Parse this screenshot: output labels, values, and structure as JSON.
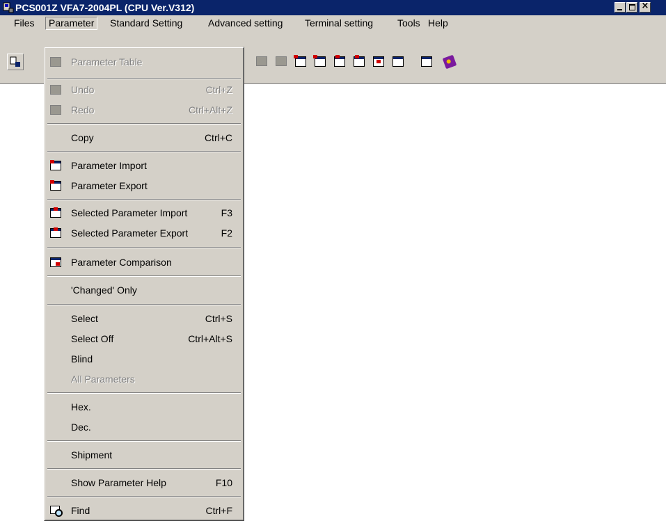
{
  "window": {
    "title": "PCS001Z VFA7-2004PL (CPU Ver.V312)",
    "close_glyph": "×"
  },
  "menubar": [
    "Files",
    "Parameter",
    "Standard Setting",
    "Advanced setting",
    "Terminal setting",
    "Tools",
    "Help"
  ],
  "open_menu": "Parameter",
  "dropdown": [
    {
      "label": "Parameter Table",
      "shortcut": "",
      "icon": "parameter-table-icon",
      "disabled": true
    },
    {
      "label": "Undo",
      "shortcut": "Ctrl+Z",
      "icon": "undo-icon",
      "disabled": true
    },
    {
      "label": "Redo",
      "shortcut": "Ctrl+Alt+Z",
      "icon": "redo-icon",
      "disabled": true
    },
    {
      "label": "Copy",
      "shortcut": "Ctrl+C",
      "icon": "",
      "disabled": false
    },
    {
      "label": "Parameter Import",
      "shortcut": "",
      "icon": "parameter-import-icon",
      "disabled": false
    },
    {
      "label": "Parameter Export",
      "shortcut": "",
      "icon": "parameter-export-icon",
      "disabled": false
    },
    {
      "label": "Selected Parameter Import",
      "shortcut": "F3",
      "icon": "selected-import-icon",
      "disabled": false
    },
    {
      "label": "Selected Parameter Export",
      "shortcut": "F2",
      "icon": "selected-export-icon",
      "disabled": false
    },
    {
      "label": "Parameter Comparison",
      "shortcut": "",
      "icon": "parameter-comparison-icon",
      "disabled": false
    },
    {
      "label": "'Changed' Only",
      "shortcut": "",
      "icon": "",
      "disabled": false
    },
    {
      "label": "Select",
      "shortcut": "Ctrl+S",
      "icon": "",
      "disabled": false
    },
    {
      "label": "Select Off",
      "shortcut": "Ctrl+Alt+S",
      "icon": "",
      "disabled": false
    },
    {
      "label": "Blind",
      "shortcut": "",
      "icon": "",
      "disabled": false
    },
    {
      "label": "All Parameters",
      "shortcut": "",
      "icon": "",
      "disabled": true
    },
    {
      "label": "Hex.",
      "shortcut": "",
      "icon": "",
      "disabled": false
    },
    {
      "label": "Dec.",
      "shortcut": "",
      "icon": "",
      "disabled": false
    },
    {
      "label": "Shipment",
      "shortcut": "",
      "icon": "",
      "disabled": false
    },
    {
      "label": "Show Parameter Help",
      "shortcut": "F10",
      "icon": "",
      "disabled": false
    },
    {
      "label": "Find",
      "shortcut": "Ctrl+F",
      "icon": "find-icon",
      "disabled": false
    }
  ],
  "toolbar_icons": [
    "app-toolbar-icon",
    "undo-icon",
    "redo-icon",
    "parameter-import-icon",
    "parameter-export-icon",
    "selected-import-icon",
    "selected-export-icon",
    "parameter-comparison-icon",
    "find-icon",
    "check-window-icon",
    "help-book-icon"
  ],
  "colors": {
    "titlebar": "#0a246a",
    "face": "#d4d0c8",
    "disabled_text": "#808080"
  }
}
